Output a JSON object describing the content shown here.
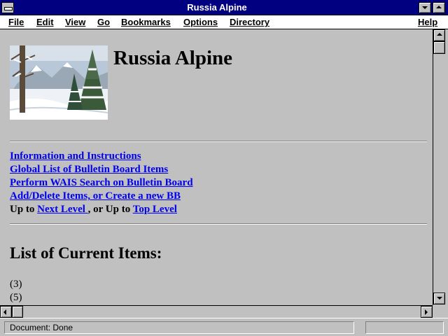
{
  "window": {
    "title": "Russia Alpine"
  },
  "menu": {
    "file": "File",
    "edit": "Edit",
    "view": "View",
    "go": "Go",
    "bookmarks": "Bookmarks",
    "options": "Options",
    "directory": "Directory",
    "help": "Help"
  },
  "page": {
    "heading": "Russia Alpine",
    "links": {
      "info": "Information and Instructions",
      "global_list": "Global List of Bulletin Board Items",
      "wais_search": "Perform WAIS Search on Bulletin Board",
      "add_delete": "Add/Delete Items, or Create a new BB"
    },
    "up": {
      "prefix": "Up to ",
      "next_level": "Next Level ",
      "middle": ", or Up to ",
      "top_level": "Top Level "
    },
    "list_heading": "List of Current Items:",
    "items": [
      "(3)",
      "(5)"
    ]
  },
  "status": {
    "text": "Document: Done",
    "progress": 0
  }
}
